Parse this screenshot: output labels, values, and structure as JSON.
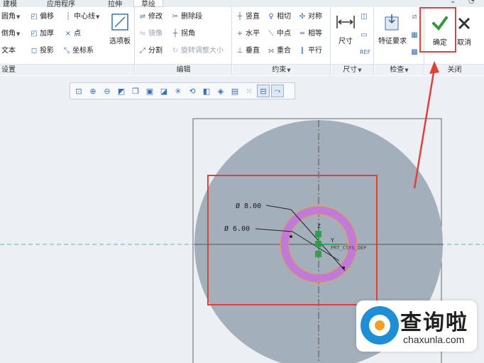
{
  "tabs": [
    "建模",
    "应用程序",
    "拉伸",
    "草绘"
  ],
  "active_tab": "草绘",
  "groups": {
    "operations": {
      "title": "设置",
      "items": [
        {
          "label": "圆角",
          "icon": "fillet-icon"
        },
        {
          "label": "偏移",
          "icon": "offset-icon"
        },
        {
          "label": "中心线",
          "icon": "centerline-icon"
        },
        {
          "label": "倒角",
          "icon": "chamfer-icon"
        },
        {
          "label": "加厚",
          "icon": "thicken-icon"
        },
        {
          "label": "点",
          "icon": "point-icon"
        },
        {
          "label": "文本",
          "icon": "text-icon"
        },
        {
          "label": "投影",
          "icon": "project-icon"
        },
        {
          "label": "坐标系",
          "icon": "coordinate-system-icon"
        }
      ],
      "palette_label": "选项板"
    },
    "edit": {
      "title": "编辑",
      "items": [
        {
          "label": "修改",
          "icon": "modify-icon"
        },
        {
          "label": "删除段",
          "icon": "delete-segment-icon"
        },
        {
          "label": "镜像",
          "icon": "mirror-icon"
        },
        {
          "label": "拐角",
          "icon": "corner-icon"
        },
        {
          "label": "分割",
          "icon": "divide-icon"
        },
        {
          "label": "旋转调整大小",
          "icon": "rotate-resize-icon"
        }
      ]
    },
    "constraints": {
      "title": "约束",
      "items": [
        {
          "label": "竖直",
          "icon": "vertical-icon"
        },
        {
          "label": "相切",
          "icon": "tangent-icon"
        },
        {
          "label": "对称",
          "icon": "symmetric-icon"
        },
        {
          "label": "水平",
          "icon": "horizontal-icon"
        },
        {
          "label": "中点",
          "icon": "midpoint-icon"
        },
        {
          "label": "相等",
          "icon": "equal-icon"
        },
        {
          "label": "垂直",
          "icon": "perpendicular-icon"
        },
        {
          "label": "重合",
          "icon": "coincident-icon"
        },
        {
          "label": "平行",
          "icon": "parallel-icon"
        }
      ]
    },
    "dimension": {
      "title": "尺寸",
      "label": "尺寸"
    },
    "inspect": {
      "title": "检查",
      "feature_req": "特征要求"
    },
    "close": {
      "title": "关闭",
      "ok": "确定",
      "cancel": "取消"
    }
  },
  "sketch": {
    "dim_outer": "Ø 8.00",
    "dim_inner": "Ø 6.00",
    "axis_z": "Z",
    "axis_y": "Y",
    "csys_label": "PRT_CSYS_DEF"
  },
  "watermark": {
    "cn": "查询啦",
    "en": "chaxunla.com"
  },
  "colors": {
    "accent": "#3a6fb0",
    "highlight": "#e0403a",
    "confirm": "#2e9a3a"
  }
}
